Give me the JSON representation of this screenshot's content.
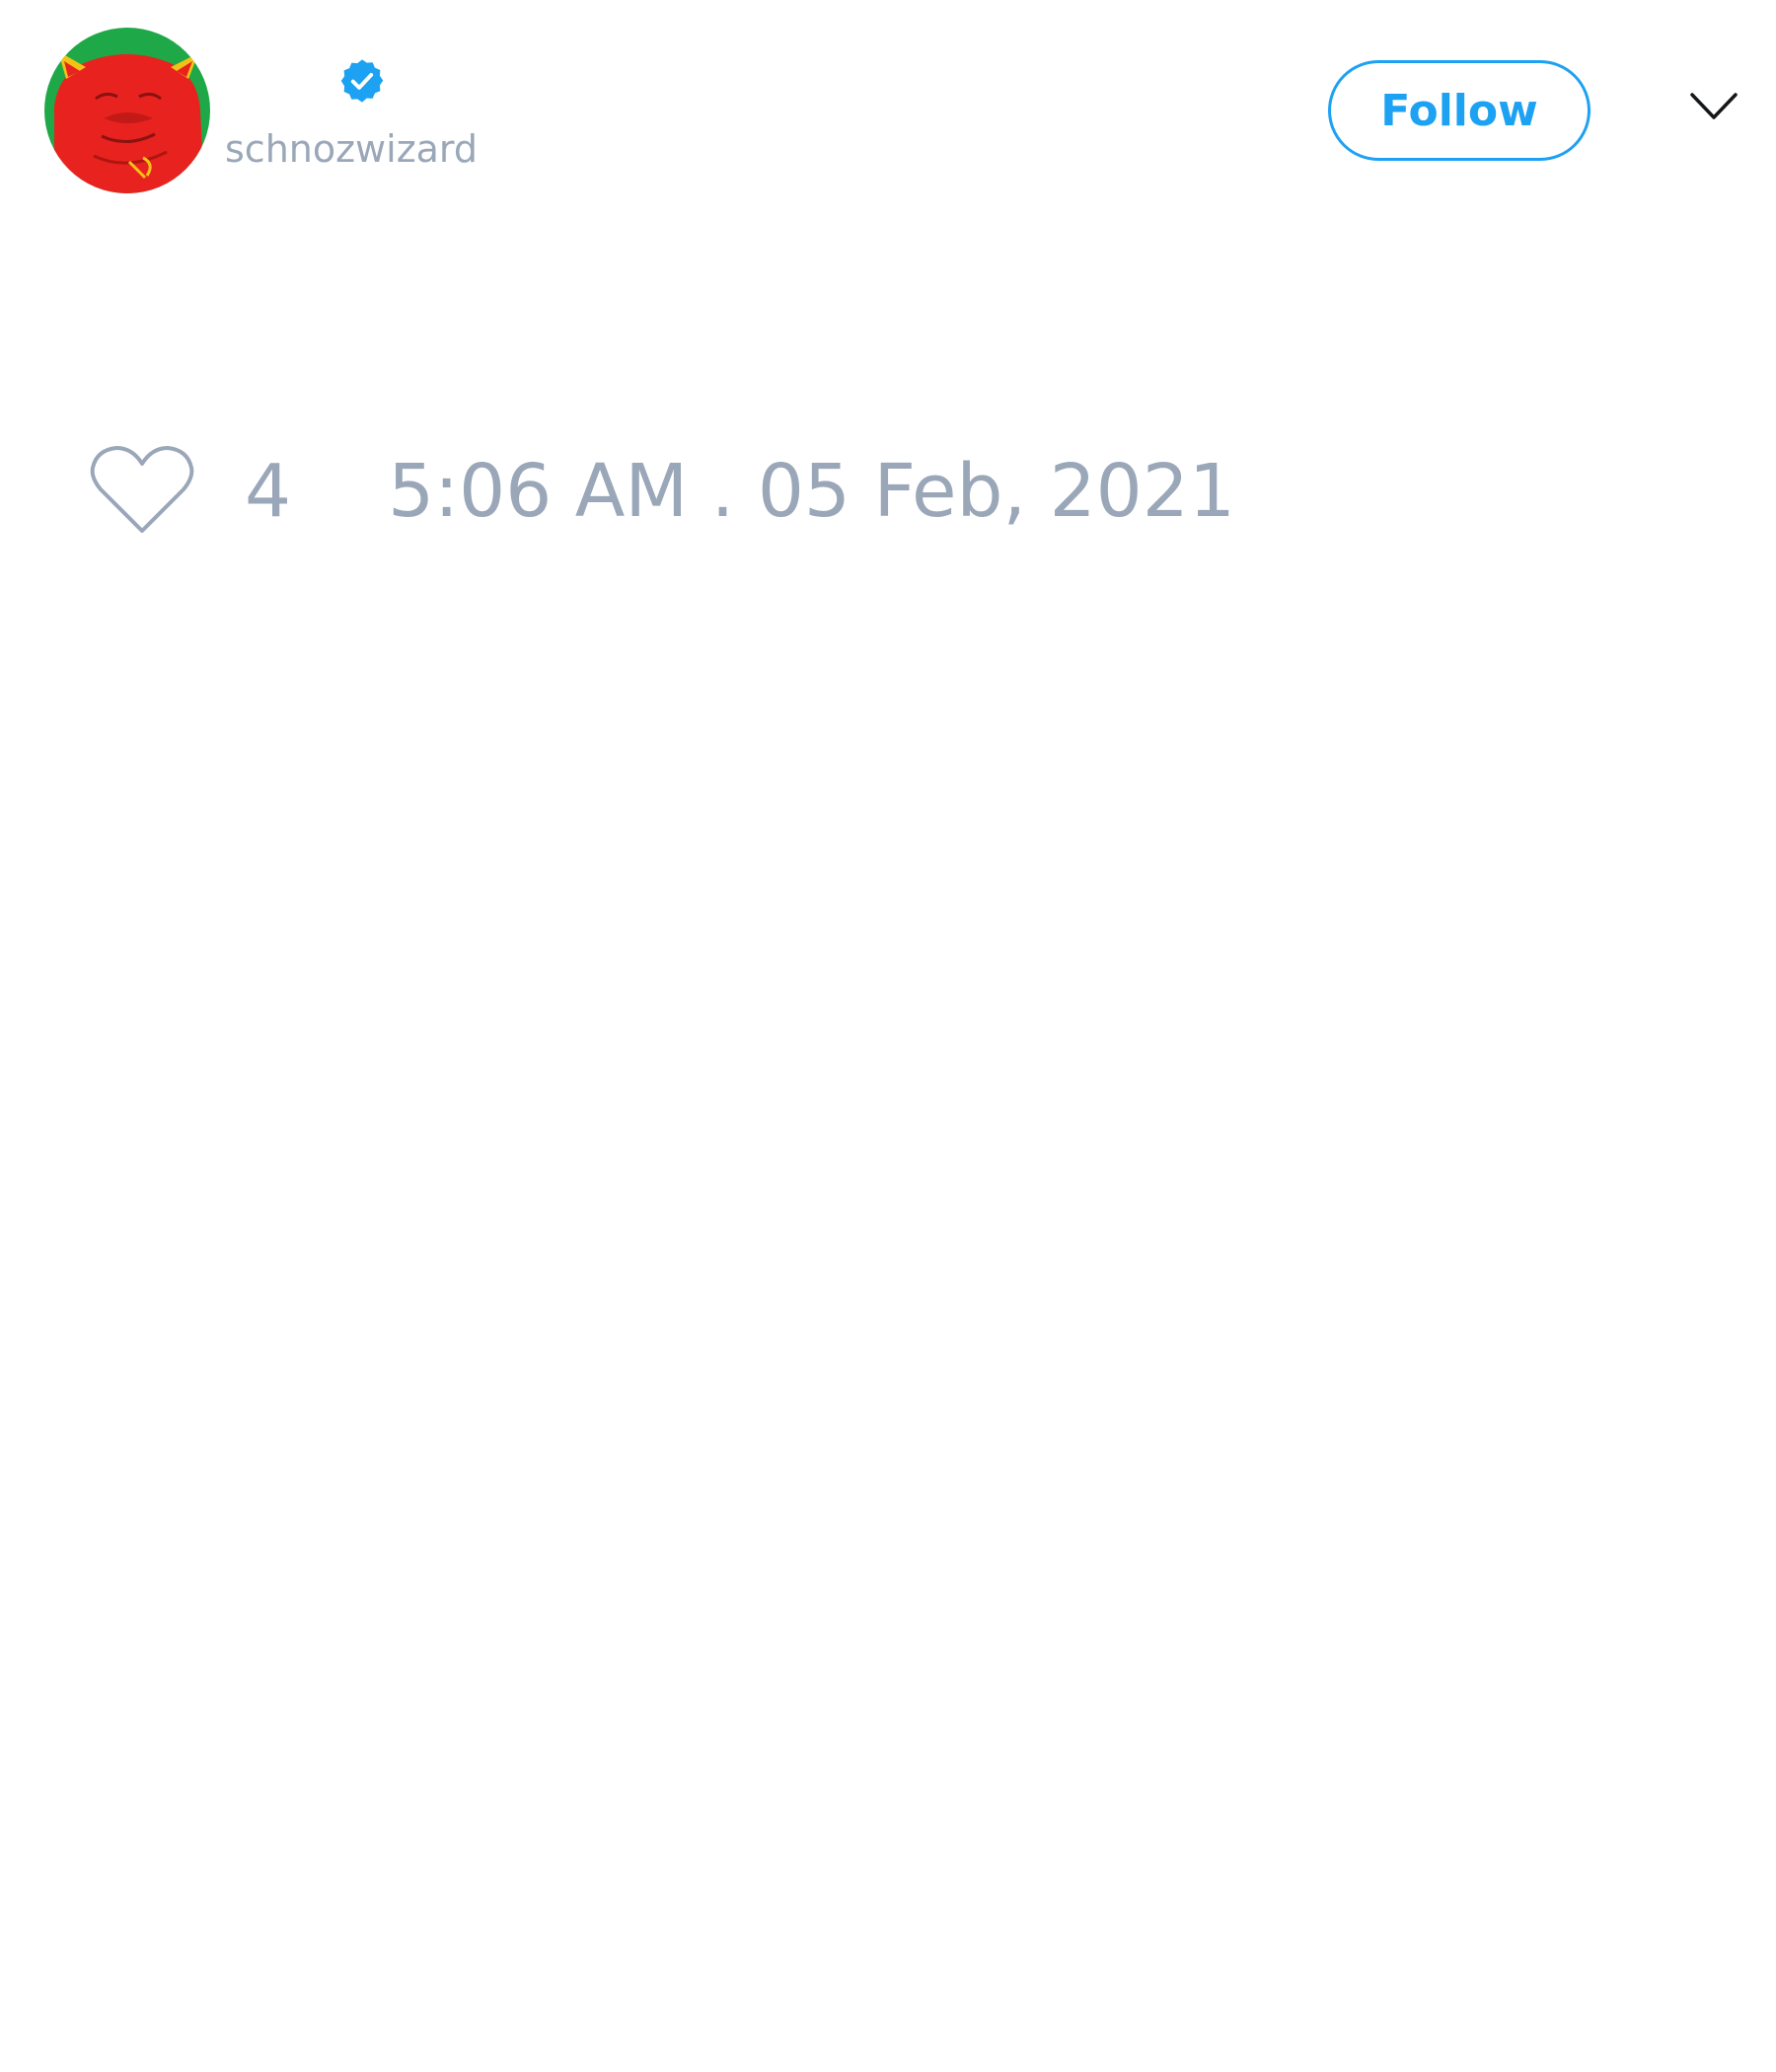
{
  "author": {
    "display_name": "",
    "username": "schnozwizard",
    "verified": true,
    "avatar_icon": "red-creature-avatar-icon"
  },
  "header": {
    "follow_label": "Follow",
    "menu_icon": "chevron-down-icon"
  },
  "stats": {
    "likes_icon": "heart-outline-icon",
    "like_count": "4",
    "timestamp": "5:06 AM . 05 Feb, 2021"
  },
  "colors": {
    "accent": "#1da1f2",
    "muted_text": "#9aa7b8",
    "avatar_bg": "#1fa847",
    "avatar_creature": "#e8231f"
  }
}
